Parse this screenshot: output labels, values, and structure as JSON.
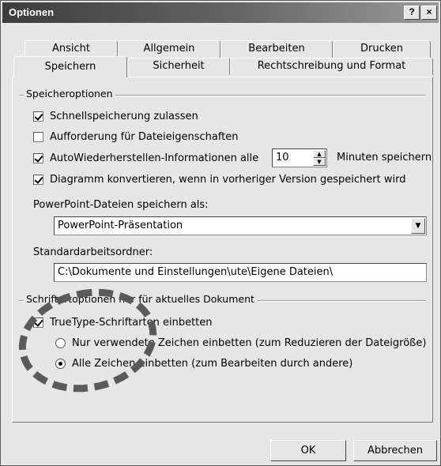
{
  "window": {
    "title": "Optionen",
    "help_label": "?",
    "close_label": "×"
  },
  "tabs": {
    "row_back": [
      "Ansicht",
      "Allgemein",
      "Bearbeiten",
      "Drucken"
    ],
    "row_front": [
      "Speichern",
      "Sicherheit",
      "Rechtschreibung und Format"
    ],
    "active": "Speichern"
  },
  "save_options": {
    "group_label": "Speicheroptionen",
    "fast_save": {
      "label": "Schnellspeicherung zulassen",
      "checked": true
    },
    "prompt_properties": {
      "label": "Aufforderung für Dateieigenschaften",
      "checked": false
    },
    "autorecover": {
      "label": "AutoWiederherstellen-Informationen alle",
      "checked": true,
      "value": "10",
      "suffix": "Minuten speichern"
    },
    "convert_charts": {
      "label": "Diagramm konvertieren, wenn in vorheriger Version gespeichert wird",
      "checked": true
    },
    "save_as_label": "PowerPoint-Dateien speichern als:",
    "save_as_value": "PowerPoint-Präsentation",
    "default_folder_label": "Standardarbeitsordner:",
    "default_folder_value": "C:\\Dokumente und Einstellungen\\ute\\Eigene Dateien\\"
  },
  "font_options": {
    "group_label": "Schriftartoptionen nur für aktuelles Dokument",
    "embed_truetype": {
      "label": "TrueType-Schriftarten einbetten",
      "checked": true
    },
    "only_used": {
      "label": "Nur verwendete Zeichen einbetten (zum Reduzieren der Dateigröße)",
      "selected": false
    },
    "all_chars": {
      "label": "Alle Zeichen einbetten (zum Bearbeiten durch andere)",
      "selected": true
    }
  },
  "buttons": {
    "ok": "OK",
    "cancel": "Abbrechen"
  }
}
